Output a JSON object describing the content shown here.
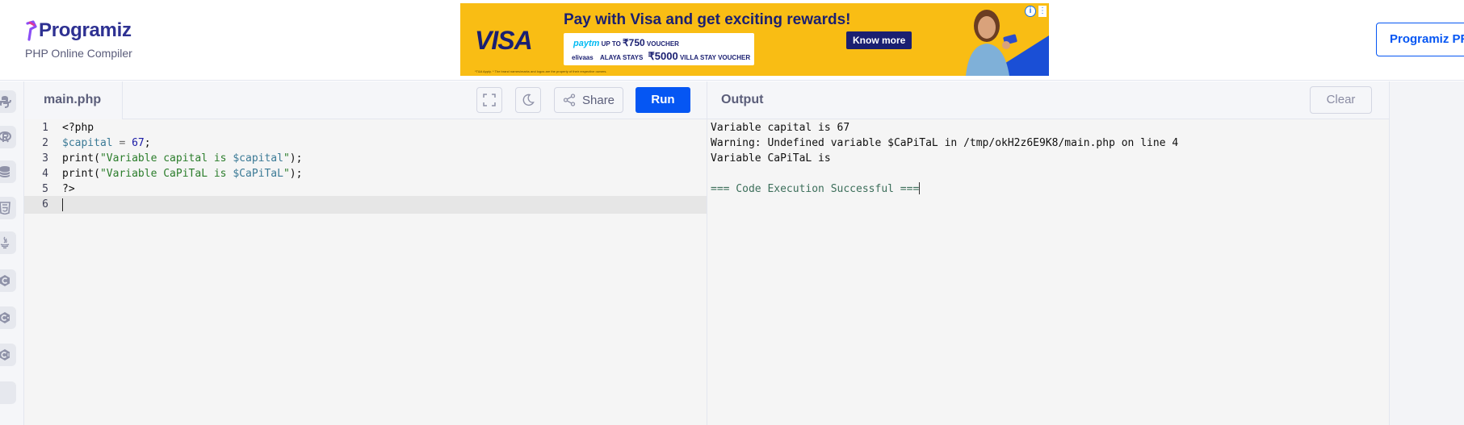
{
  "header": {
    "logo_text": "Programiz",
    "subtitle": "PHP Online Compiler",
    "pro_button": "Programiz PRO"
  },
  "ad": {
    "brand": "VISA",
    "headline": "Pay with Visa and get exciting rewards!",
    "line1_brand": "paytm",
    "line1_prefix": "UP TO",
    "line1_amount": "₹750",
    "line1_suffix": "VOUCHER",
    "line2_brand1": "elivaas",
    "line2_brand2": "ALAYA STAYS",
    "line2_amount": "₹5000",
    "line2_suffix": "VILLA STAY VOUCHER",
    "cta": "Know more",
    "fine_print": "*T&A Apply. * The brand names/marks and logos are the property of their respective owners.",
    "accent_color": "#f9bd14",
    "brand_color": "#1a1f71"
  },
  "sidebar": {
    "icons": [
      "python-icon",
      "r-icon",
      "sql-icon",
      "html-icon",
      "java-icon",
      "c-icon",
      "cpp-icon",
      "csharp-icon"
    ]
  },
  "editor": {
    "file_name": "main.php",
    "share_label": "Share",
    "run_label": "Run",
    "lines": [
      {
        "num": "1",
        "parts": [
          {
            "t": "<?php",
            "c": "plain"
          }
        ]
      },
      {
        "num": "2",
        "parts": [
          {
            "t": "$capital",
            "c": "var"
          },
          {
            "t": " = ",
            "c": "op"
          },
          {
            "t": "67",
            "c": "num"
          },
          {
            "t": ";",
            "c": "plain"
          }
        ]
      },
      {
        "num": "3",
        "parts": [
          {
            "t": "print(",
            "c": "plain"
          },
          {
            "t": "\"Variable capital is ",
            "c": "str"
          },
          {
            "t": "$capital",
            "c": "var"
          },
          {
            "t": "\"",
            "c": "str"
          },
          {
            "t": ");",
            "c": "plain"
          }
        ]
      },
      {
        "num": "4",
        "parts": [
          {
            "t": "print(",
            "c": "plain"
          },
          {
            "t": "\"Variable CaPiTaL is ",
            "c": "str"
          },
          {
            "t": "$CaPiTaL",
            "c": "var"
          },
          {
            "t": "\"",
            "c": "str"
          },
          {
            "t": ");",
            "c": "plain"
          }
        ]
      },
      {
        "num": "5",
        "parts": [
          {
            "t": "?>",
            "c": "plain"
          }
        ]
      },
      {
        "num": "6",
        "parts": []
      }
    ],
    "active_line": "6"
  },
  "output": {
    "title": "Output",
    "clear_label": "Clear",
    "lines": [
      "Variable capital is 67",
      "Warning: Undefined variable $CaPiTaL in /tmp/okH2z6E9K8/main.php on line 4",
      "Variable CaPiTaL is",
      "",
      "=== Code Execution Successful ==="
    ]
  },
  "colors": {
    "run_button": "#0556f3",
    "panel_bg": "#f5f5f5",
    "toolbar_bg": "#f5f6f9"
  }
}
